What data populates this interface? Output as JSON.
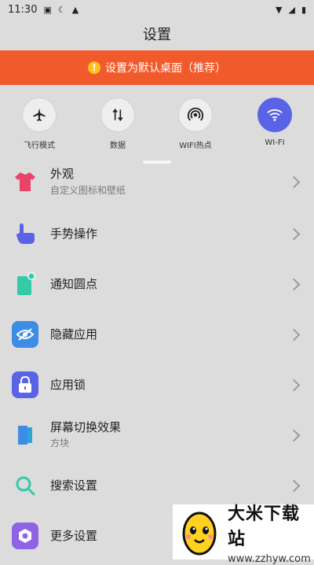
{
  "status": {
    "time": "11:30"
  },
  "header": {
    "title": "设置"
  },
  "banner": {
    "text": "设置为默认桌面（推荐）",
    "color": "#f15b2c"
  },
  "quick": [
    {
      "label": "飞行模式",
      "icon": "airplane-icon"
    },
    {
      "label": "数据",
      "icon": "data-arrows-icon"
    },
    {
      "label": "WIFI热点",
      "icon": "hotspot-icon"
    },
    {
      "label": "WI-FI",
      "icon": "wifi-icon",
      "active": true,
      "color": "#5a63e6"
    }
  ],
  "menu": [
    {
      "title": "外观",
      "subtitle": "自定义图标和壁纸",
      "icon": "tshirt-icon"
    },
    {
      "title": "手势操作",
      "icon": "gesture-hand-icon"
    },
    {
      "title": "通知圆点",
      "icon": "notification-dot-icon"
    },
    {
      "title": "隐藏应用",
      "icon": "hidden-eye-icon"
    },
    {
      "title": "应用锁",
      "icon": "lock-icon"
    },
    {
      "title": "屏幕切换效果",
      "subtitle": "方块",
      "icon": "screen-transition-icon"
    },
    {
      "title": "搜索设置",
      "icon": "search-icon"
    },
    {
      "title": "更多设置",
      "icon": "more-settings-icon"
    }
  ],
  "watermark": {
    "main": "大米下载站",
    "url": "www.zzhyw.com"
  }
}
